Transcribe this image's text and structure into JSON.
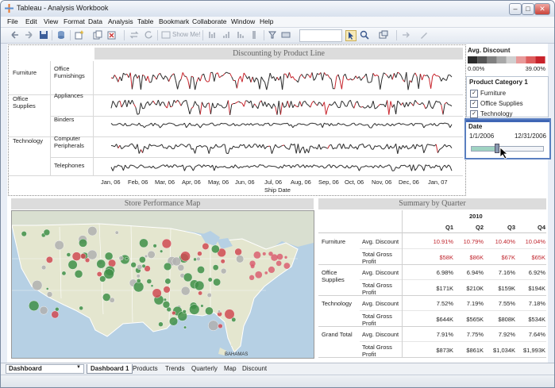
{
  "window": {
    "title": "Tableau - Analysis Workbook"
  },
  "menu": [
    "File",
    "Edit",
    "View",
    "Format",
    "Data",
    "Analysis",
    "Table",
    "Bookmark",
    "Collaborate",
    "Window",
    "Help"
  ],
  "toolbar": {
    "show_me": "Show Me!"
  },
  "discount_chart": {
    "title": "Discounting by Product Line",
    "categories": [
      {
        "name": "Furniture",
        "products": [
          "Office Furnishings"
        ]
      },
      {
        "name": "Office Supplies",
        "products": [
          "Appliances",
          "Binders"
        ]
      },
      {
        "name": "Technology",
        "products": [
          "Computer Peripherals",
          "Telephones"
        ]
      }
    ],
    "x_ticks": [
      "Jan, 06",
      "Feb, 06",
      "Mar, 06",
      "Apr, 06",
      "May, 06",
      "Jun, 06",
      "Jul, 06",
      "Aug, 06",
      "Sep, 06",
      "Oct, 06",
      "Nov, 06",
      "Dec, 06",
      "Jan, 07"
    ],
    "x_label": "Ship Date"
  },
  "legend": {
    "title": "Avg. Discount",
    "min": "0.00%",
    "max": "39.00%",
    "colors": [
      "#2b2b2b",
      "#555555",
      "#808080",
      "#a8a8a8",
      "#d0d0d0",
      "#e89a9a",
      "#de5d5d",
      "#c8232b"
    ]
  },
  "category_filter": {
    "title": "Product Category 1",
    "items": [
      "Furniture",
      "Office Supplies",
      "Technology"
    ]
  },
  "date_filter": {
    "title": "Date",
    "start": "1/1/2006",
    "end": "12/31/2006",
    "position": 0.33
  },
  "map": {
    "title": "Store Performance Map",
    "label": "BAHAMAS"
  },
  "summary": {
    "title": "Summary by Quarter",
    "year": "2010",
    "quarters": [
      "Q1",
      "Q2",
      "Q3",
      "Q4"
    ],
    "rows": [
      {
        "category": "Furniture",
        "discount": [
          "10.91%",
          "10.79%",
          "10.40%",
          "10.04%"
        ],
        "profit": [
          "$58K",
          "$86K",
          "$67K",
          "$65K"
        ],
        "highlight": true
      },
      {
        "category": "Office Supplies",
        "discount": [
          "6.98%",
          "6.94%",
          "7.16%",
          "6.92%"
        ],
        "profit": [
          "$171K",
          "$210K",
          "$159K",
          "$194K"
        ],
        "highlight": false
      },
      {
        "category": "Technology",
        "discount": [
          "7.52%",
          "7.19%",
          "7.55%",
          "7.18%"
        ],
        "profit": [
          "$644K",
          "$565K",
          "$808K",
          "$534K"
        ],
        "highlight": false
      },
      {
        "category": "Grand Total",
        "discount": [
          "7.91%",
          "7.75%",
          "7.92%",
          "7.64%"
        ],
        "profit": [
          "$873K",
          "$861K",
          "$1,034K",
          "$1,993K"
        ],
        "highlight": false
      }
    ],
    "measure_discount": "Avg. Discount",
    "measure_profit": "Total Gross Profit"
  },
  "sheet_tabs": {
    "selector": "Dashboard",
    "tabs": [
      "Dashboard 1",
      "Products",
      "Trends",
      "Quarterly",
      "Map",
      "Discount"
    ]
  },
  "colors": {
    "accent_red": "#c0252d",
    "panel_header": "#dcdcdc"
  }
}
